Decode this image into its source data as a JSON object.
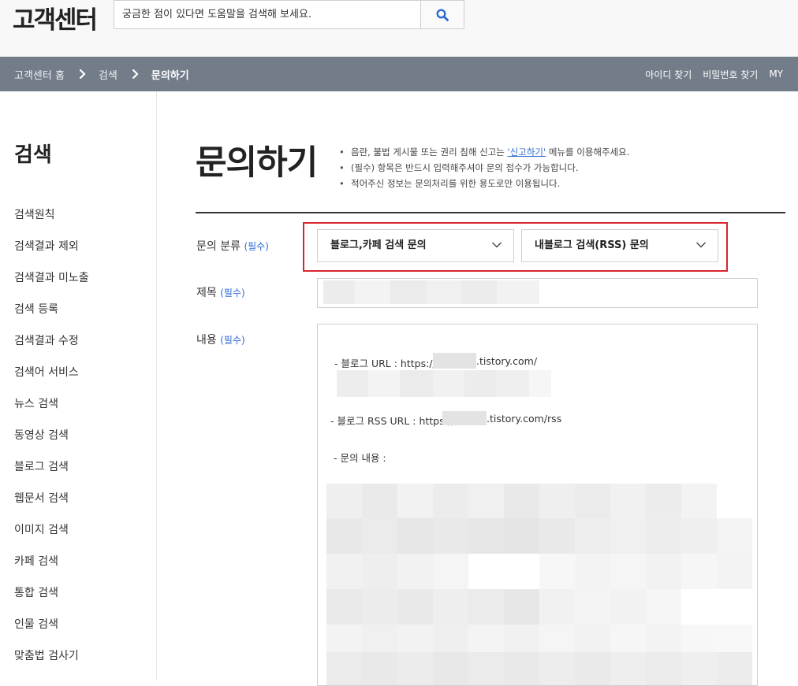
{
  "header": {
    "logo": "고객센터",
    "search_placeholder": "궁금한 점이 있다면 도움말을 검색해 보세요."
  },
  "breadcrumb": [
    "고객센터 홈",
    "검색",
    "문의하기"
  ],
  "top_links": [
    "아이디 찾기",
    "비밀번호 찾기",
    "MY"
  ],
  "sidebar": {
    "title": "검색",
    "items": [
      "검색원칙",
      "검색결과 제외",
      "검색결과 미노출",
      "검색 등록",
      "검색결과 수정",
      "검색어 서비스",
      "뉴스 검색",
      "동영상 검색",
      "블로그 검색",
      "웹문서 검색",
      "이미지 검색",
      "카페 검색",
      "통합 검색",
      "인물 검색",
      "맞춤법 검사기"
    ]
  },
  "page": {
    "title": "문의하기",
    "notice1_pre": "음란, 불법 게시물 또는 권리 침해 신고는 ",
    "notice1_link": "'신고하기'",
    "notice1_post": " 메뉴를 이용해주세요.",
    "notice2": "(필수) 항목은 반드시 입력해주셔야 문의 접수가 가능합니다.",
    "notice3": "적어주신 정보는 문의처리를 위한 용도로만 이용됩니다."
  },
  "form": {
    "category_label": "문의 분류",
    "title_label": "제목",
    "content_label": "내용",
    "required": "(필수)",
    "select1": "블로그,카페 검색 문의",
    "select2": "내블로그 검색(RSS) 문의",
    "content": {
      "line1_pre": "- 블로그 URL : https://",
      "line1_post": ".tistory.com/",
      "line2_pre": "- 블로그 RSS URL : https://",
      "line2_post": ".tistory.com/rss",
      "line3": "- 문의 내용 :"
    }
  },
  "colors": {
    "navbar": "#737d89",
    "accent_blue": "#2c6bd4",
    "highlight_red": "#d8262f"
  }
}
